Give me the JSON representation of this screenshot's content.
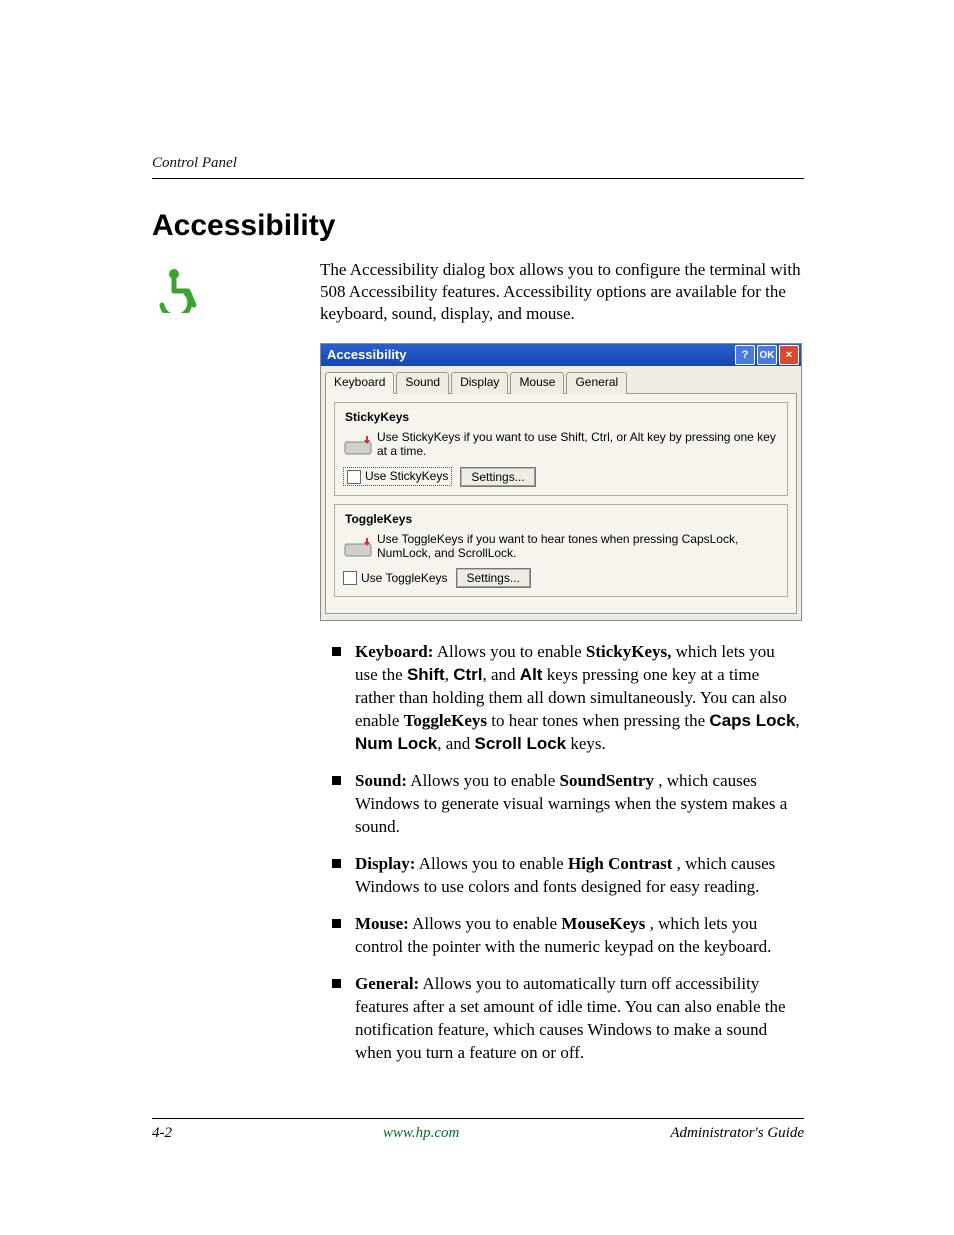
{
  "header": {
    "breadcrumb": "Control Panel"
  },
  "section": {
    "title": "Accessibility",
    "intro": "The Accessibility dialog box allows you to configure the terminal with 508 Accessibility features. Accessibility options are available for the keyboard, sound, display, and mouse."
  },
  "dialog": {
    "title": "Accessibility",
    "buttons": {
      "help": "?",
      "ok": "OK",
      "close": "×"
    },
    "tabs": [
      "Keyboard",
      "Sound",
      "Display",
      "Mouse",
      "General"
    ],
    "active_tab": "Keyboard",
    "sticky": {
      "legend": "StickyKeys",
      "desc": "Use StickyKeys if you want to use Shift, Ctrl, or Alt key by pressing one key at a time.",
      "checkbox": "Use StickyKeys",
      "settings": "Settings..."
    },
    "toggle": {
      "legend": "ToggleKeys",
      "desc": "Use ToggleKeys if you want to hear tones when pressing CapsLock, NumLock, and ScrollLock.",
      "checkbox": "Use ToggleKeys",
      "settings": "Settings..."
    }
  },
  "bullets": {
    "kb_label": "Keyboard:",
    "kb_t1": "Allows you to enable ",
    "kb_sticky": "StickyKeys,",
    "kb_t2": " which lets you use the ",
    "kb_shift": "Shift",
    "kb_c1": ", ",
    "kb_ctrl": "Ctrl",
    "kb_c2": ", and ",
    "kb_alt": "Alt",
    "kb_t3": " keys pressing one key at a time rather than holding them all down simultaneously. You can also enable ",
    "kb_toggle": "ToggleKeys",
    "kb_t4": " to hear tones when pressing the ",
    "kb_caps": "Caps Lock",
    "kb_c3": ", ",
    "kb_num": "Num Lock",
    "kb_c4": ", and ",
    "kb_scroll": "Scroll Lock",
    "kb_t5": " keys.",
    "snd_label": "Sound:",
    "snd_t1": " Allows you to enable ",
    "snd_ss": "SoundSentry",
    "snd_t2": ", which causes Windows to generate visual warnings when the system makes a sound.",
    "dsp_label": "Display:",
    "dsp_t1": " Allows you to enable ",
    "dsp_hc": "High Contrast",
    "dsp_t2": ", which causes Windows to use colors and fonts designed for easy reading.",
    "ms_label": "Mouse:",
    "ms_t1": " Allows you to enable ",
    "ms_mk": "MouseKeys",
    "ms_t2": ", which lets you control the pointer with the numeric keypad on the keyboard.",
    "gen_label": "General:",
    "gen_t1": " Allows you to automatically turn off accessibility features after a set amount of idle time. You can also enable the notification feature, which causes Windows to make a sound when you turn a feature on or off."
  },
  "footer": {
    "page": "4-2",
    "url": "www.hp.com",
    "guide": "Administrator's Guide"
  }
}
